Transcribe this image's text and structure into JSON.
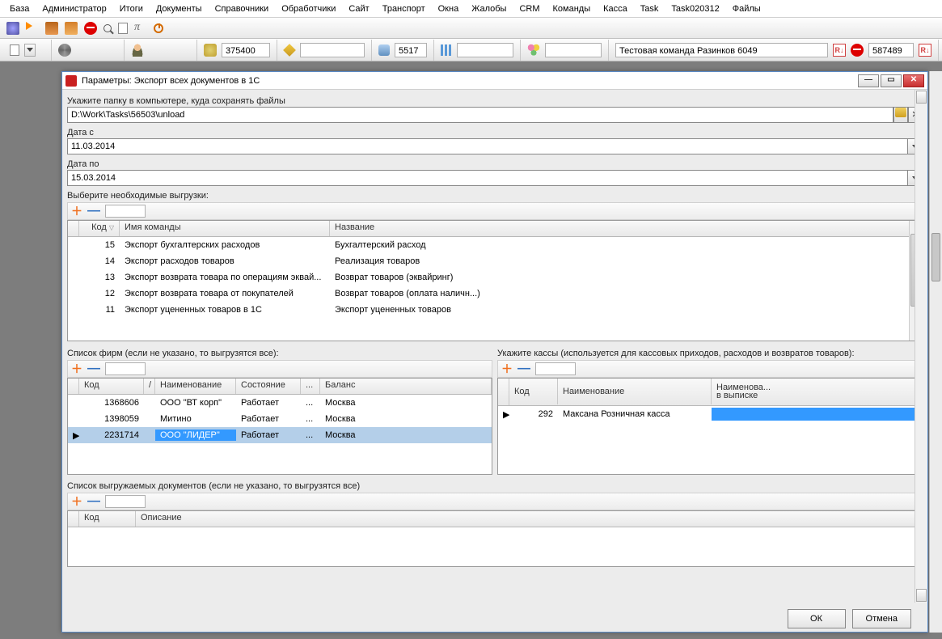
{
  "menu": [
    "База",
    "Администратор",
    "Итоги",
    "Документы",
    "Справочники",
    "Обработчики",
    "Сайт",
    "Транспорт",
    "Окна",
    "Жалобы",
    "CRM",
    "Команды",
    "Касса",
    "Task",
    "Task020312",
    "Файлы"
  ],
  "status": {
    "v1": "375400",
    "v2": "5517",
    "team": "Тестовая команда Разинков 6049",
    "v3": "587489"
  },
  "dialog": {
    "title": "Параметры: Экспорт всех документов в 1С",
    "folder_label": "Укажите папку в компьютере, куда сохранять файлы",
    "folder_path": "D:\\Work\\Tasks\\56503\\unload",
    "date_from_label": "Дата с",
    "date_from": "11.03.2014",
    "date_to_label": "Дата по",
    "date_to": "15.03.2014",
    "exports_label": "Выберите необходимые выгрузки:",
    "exports_cols": {
      "code": "Код",
      "cmd": "Имя команды",
      "name": "Название"
    },
    "exports": [
      {
        "code": "15",
        "cmd": "Экспорт бухгалтерских расходов",
        "name": "Бухгалтерский расход"
      },
      {
        "code": "14",
        "cmd": "Экспорт расходов товаров",
        "name": "Реализация товаров"
      },
      {
        "code": "13",
        "cmd": "Экспорт возврата товара по операциям эквай...",
        "name": "Возврат товаров (эквайринг)"
      },
      {
        "code": "12",
        "cmd": "Экспорт возврата товара от покупателей",
        "name": "Возврат товаров (оплата наличн...)"
      },
      {
        "code": "11",
        "cmd": "Экспорт уцененных товаров в 1С",
        "name": "Экспорт уцененных товаров"
      }
    ],
    "firms_label": "Список фирм (если не указано, то выгрузятся все):",
    "firms_cols": {
      "code": "Код",
      "sort": "/",
      "name": "Наименование",
      "state": "Состояние",
      "dots": "...",
      "bal": "Баланс"
    },
    "firms": [
      {
        "code": "1368606",
        "name": "ООО \"ВТ корп\"",
        "state": "Работает",
        "dots": "...",
        "bal": "Москва",
        "sel": false
      },
      {
        "code": "1398059",
        "name": "Митино",
        "state": "Работает",
        "dots": "...",
        "bal": "Москва",
        "sel": false
      },
      {
        "code": "2231714",
        "name": "ООО \"ЛИДЕР\"",
        "state": "Работает",
        "dots": "...",
        "bal": "Москва",
        "sel": true
      }
    ],
    "kassa_label": "Укажите кассы (используется для кассовых приходов, расходов и возвратов товаров):",
    "kassa_cols": {
      "code": "Код",
      "name": "Наименование",
      "slip1": "Наименова...",
      "slip2": "в выписке"
    },
    "kassa": [
      {
        "code": "292",
        "name": "Максана Розничная касса",
        "slip": "",
        "mark": true
      }
    ],
    "docs_label": "Список выгружаемых документов (если не указано, то выгрузятся все)",
    "docs_cols": {
      "code": "Код",
      "desc": "Описание"
    },
    "ok": "ОК",
    "cancel": "Отмена"
  }
}
